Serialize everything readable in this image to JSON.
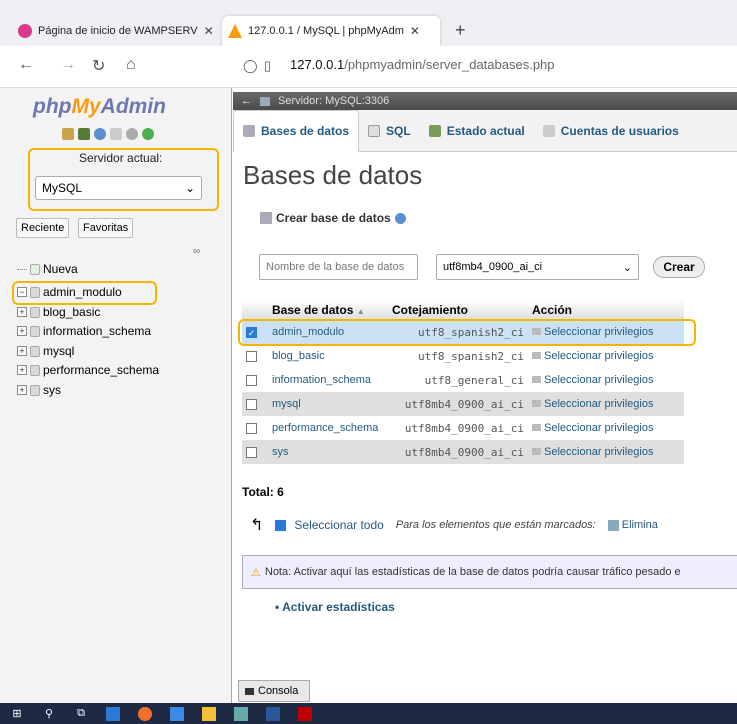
{
  "browser": {
    "tabs": [
      {
        "label": "Página de inicio de WAMPSERV",
        "active": false
      },
      {
        "label": "127.0.0.1 / MySQL | phpMyAdm",
        "active": true
      }
    ],
    "new_tab": "+",
    "url_host": "127.0.0.1",
    "url_path": "/phpmyadmin/server_databases.php"
  },
  "nav": {
    "logo": {
      "php": "php",
      "my": "My",
      "admin": "Admin"
    },
    "server_label": "Servidor actual:",
    "server_value": "MySQL",
    "recent": "Reciente",
    "favorites": "Favoritas",
    "tree": [
      {
        "label": "Nueva",
        "kind": "new"
      },
      {
        "label": "admin_modulo",
        "kind": "db"
      },
      {
        "label": "blog_basic",
        "kind": "db"
      },
      {
        "label": "information_schema",
        "kind": "db"
      },
      {
        "label": "mysql",
        "kind": "db"
      },
      {
        "label": "performance_schema",
        "kind": "db"
      },
      {
        "label": "sys",
        "kind": "db"
      }
    ]
  },
  "main": {
    "server_bar": "Servidor: MySQL:3306",
    "tabs": [
      "Bases de datos",
      "SQL",
      "Estado actual",
      "Cuentas de usuarios"
    ],
    "heading": "Bases de datos",
    "create_label": "Crear base de datos",
    "db_name_placeholder": "Nombre de la base de datos",
    "collation_selected": "utf8mb4_0900_ai_ci",
    "create_button": "Crear",
    "table": {
      "headers": [
        "Base de datos",
        "Cotejamiento",
        "Acción"
      ],
      "rows": [
        {
          "name": "admin_modulo",
          "collation": "utf8_spanish2_ci",
          "action": "Seleccionar privilegios",
          "checked": true
        },
        {
          "name": "blog_basic",
          "collation": "utf8_spanish2_ci",
          "action": "Seleccionar privilegios",
          "checked": false
        },
        {
          "name": "information_schema",
          "collation": "utf8_general_ci",
          "action": "Seleccionar privilegios",
          "checked": false
        },
        {
          "name": "mysql",
          "collation": "utf8mb4_0900_ai_ci",
          "action": "Seleccionar privilegios",
          "checked": false
        },
        {
          "name": "performance_schema",
          "collation": "utf8mb4_0900_ai_ci",
          "action": "Seleccionar privilegios",
          "checked": false
        },
        {
          "name": "sys",
          "collation": "utf8mb4_0900_ai_ci",
          "action": "Seleccionar privilegios",
          "checked": false
        }
      ],
      "total": "Total: 6"
    },
    "select_all": "Seleccionar todo",
    "for_marked": "Para los elementos que están marcados:",
    "delete": "Elimina",
    "note": "Nota: Activar aquí las estadísticas de la base de datos podría causar tráfico pesado e",
    "activate_stats": "Activar estadísticas",
    "console": "Consola"
  },
  "colors": {
    "link": "#235a81",
    "highlight": "#f4b400",
    "selected_row": "#cce1f3"
  }
}
